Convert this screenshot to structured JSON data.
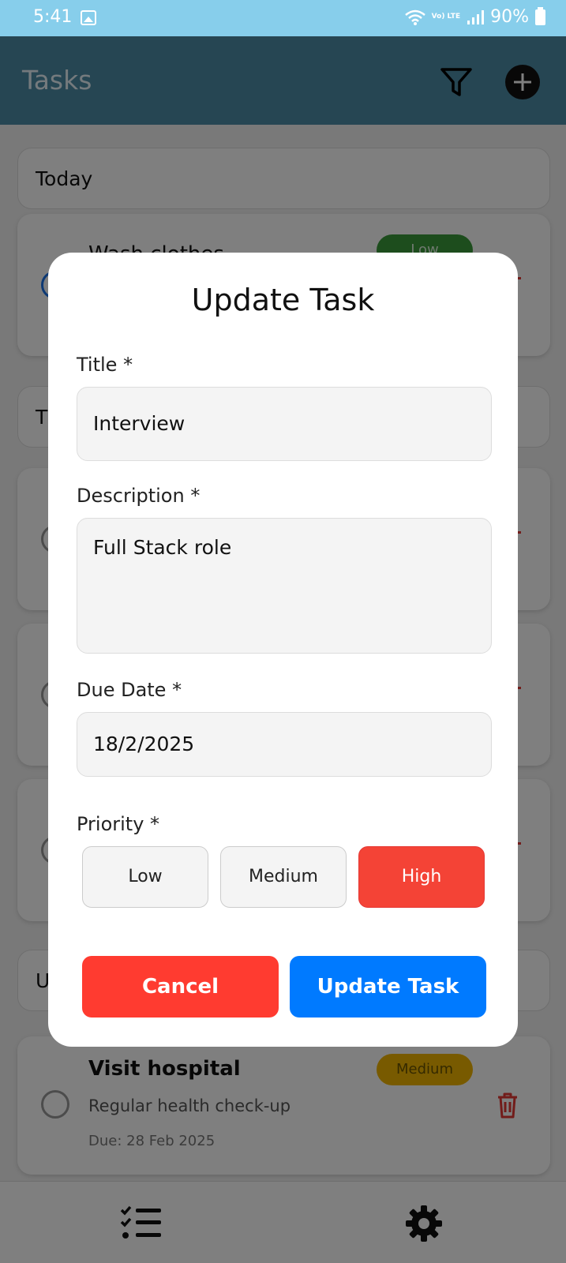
{
  "status_bar": {
    "time": "5:41",
    "network": "Vo) LTE",
    "battery": "90%"
  },
  "app_bar": {
    "title": "Tasks",
    "filter_icon": "filter-icon",
    "add_icon": "add-circle-icon"
  },
  "sections": [
    {
      "label": "Today"
    },
    {
      "label": "T"
    },
    {
      "label": "U"
    }
  ],
  "tasks": [
    {
      "title": "Wash clothes",
      "priority": "Low"
    },
    {
      "title": "Visit hospital",
      "description": "Regular health check-up",
      "due": "Due: 28 Feb 2025",
      "priority": "Medium"
    }
  ],
  "bottom_nav": {
    "tasks_icon": "checklist-icon",
    "settings_icon": "gear-icon"
  },
  "modal": {
    "title": "Update Task",
    "title_label": "Title *",
    "title_value": "Interview",
    "description_label": "Description *",
    "description_value": "Full Stack role",
    "due_label": "Due Date *",
    "due_value": "18/2/2025",
    "priority_label": "Priority *",
    "priorities": [
      "Low",
      "Medium",
      "High"
    ],
    "selected_priority": "High",
    "cancel_label": "Cancel",
    "submit_label": "Update Task"
  },
  "colors": {
    "app_bar": "#4c8ca6",
    "status_bar": "#87ceeb",
    "priority_high": "#f44336",
    "cancel": "#ff3b30",
    "submit": "#007aff"
  }
}
